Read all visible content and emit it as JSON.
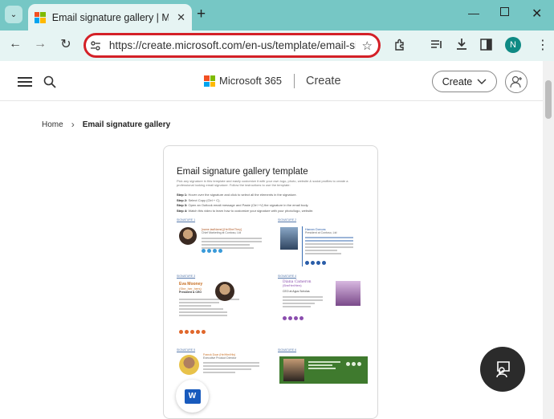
{
  "browser": {
    "tab_title": "Email signature gallery | Micro",
    "url": "https://create.microsoft.com/en-us/template/email-sig...",
    "profile_initial": "N"
  },
  "site": {
    "brand": "Microsoft 365",
    "section": "Create",
    "create_button": "Create"
  },
  "breadcrumb": {
    "home": "Home",
    "current": "Email signature gallery"
  },
  "preview": {
    "title": "Email signature gallery template",
    "intro": "Pick any signature in this template and easily customize it with your own logo, photo, website & social profiles to create a professional looking email signature. Follow the instructions to use the template:",
    "steps": [
      {
        "label": "Step 1:",
        "text": "Hover over the signature and click to select all the elements in the signature."
      },
      {
        "label": "Step 2:",
        "text": "Select Copy (Ctrl + C)."
      },
      {
        "label": "Step 3:",
        "text": "Open an Outlook email message and Paste (Ctrl +V) the signature in the email body."
      },
      {
        "label": "Step 4:",
        "text": "Watch this video to learn how to customize your signature with your photo/logo, website."
      }
    ],
    "signatures": [
      {
        "label": "SIGNATURE 1",
        "name": "[name.lastName] [He/She/They]",
        "title": "Chief Marketing at Contoso, Ltd"
      },
      {
        "label": "SIGNATURE 2",
        "name": "Hanan Dorcas",
        "title": "President at Contoso, Ltd"
      },
      {
        "label": "SIGNATURE 3",
        "name": "Eva Mooney",
        "pronoun": "(She_her_hers)",
        "title": "President & CEO"
      },
      {
        "label": "SIGNATURE 4",
        "name": "Diana Cameron",
        "pronoun": "(She/Her/Hers)",
        "title": "CEO at Agus Scholas"
      },
      {
        "label": "SIGNATURE 5",
        "name": "Franck Doar (He/Him/His)",
        "title": "Executive Product Director"
      },
      {
        "label": "SIGNATURE 6",
        "name": "",
        "title": ""
      }
    ]
  },
  "colors": {
    "chrome": "#76c7c5",
    "toolbar": "#e6f4f3",
    "highlight": "#d42027",
    "word": "#185abd",
    "sig6_green": "#3f7a2e"
  },
  "icons": [
    "tab-list-icon",
    "close-icon",
    "new-tab-icon",
    "minimize-icon",
    "maximize-icon",
    "window-close-icon",
    "back-icon",
    "forward-icon",
    "reload-icon",
    "site-info-icon",
    "bookmark-star-icon",
    "extensions-icon",
    "reading-list-icon",
    "download-icon",
    "side-panel-icon",
    "more-menu-icon",
    "hamburger-menu-icon",
    "search-icon",
    "chevron-down-icon",
    "person-icon",
    "word-icon",
    "chat-feedback-icon"
  ]
}
